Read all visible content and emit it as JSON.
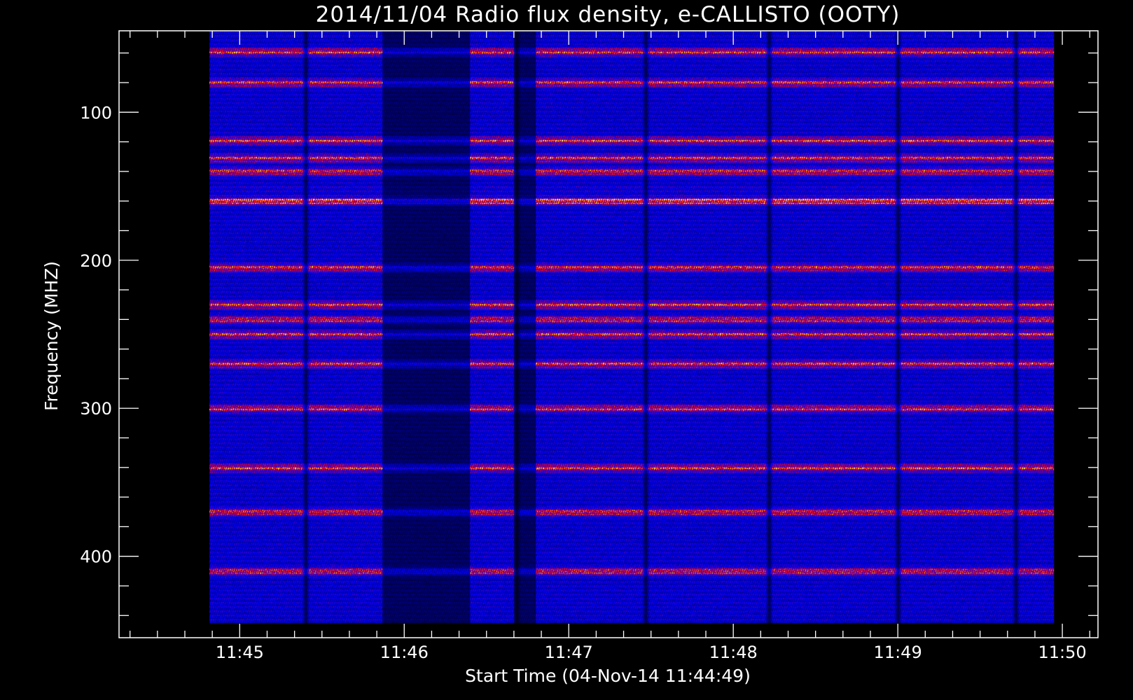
{
  "chart_data": {
    "type": "heatmap",
    "title": "2014/11/04  Radio flux density, e-CALLISTO (OOTY)",
    "xlabel": "Start Time (04-Nov-14 11:44:49)",
    "ylabel": "Frequency (MHZ)",
    "x_tick_labels": [
      "11:45",
      "11:46",
      "11:47",
      "11:48",
      "11:49",
      "11:50"
    ],
    "y_tick_labels": [
      "100",
      "200",
      "300",
      "400"
    ],
    "y_ticks": [
      100,
      200,
      300,
      400
    ],
    "xlim": [
      "11:44:16",
      "11:50:13"
    ],
    "ylim": [
      455,
      45
    ],
    "data_time_range": [
      "11:44:49",
      "11:49:57"
    ],
    "data_freq_range": [
      45,
      445
    ],
    "colormap": [
      "#000000",
      "#0000ff",
      "#ff0000",
      "#ffff00",
      "#ffffff"
    ],
    "bright_bands_mhz": [
      59,
      80,
      119,
      131,
      140,
      153,
      160,
      205,
      230,
      240,
      250,
      270,
      300,
      340,
      370,
      410
    ],
    "low_signal_time_spans": [
      [
        "11:45:52",
        "11:46:24"
      ],
      [
        "11:46:40",
        "11:46:48"
      ]
    ],
    "dark_vertical_stripes": [
      "11:45:24",
      "11:46:41",
      "11:47:28",
      "11:48:13",
      "11:49:00",
      "11:49:43"
    ]
  }
}
